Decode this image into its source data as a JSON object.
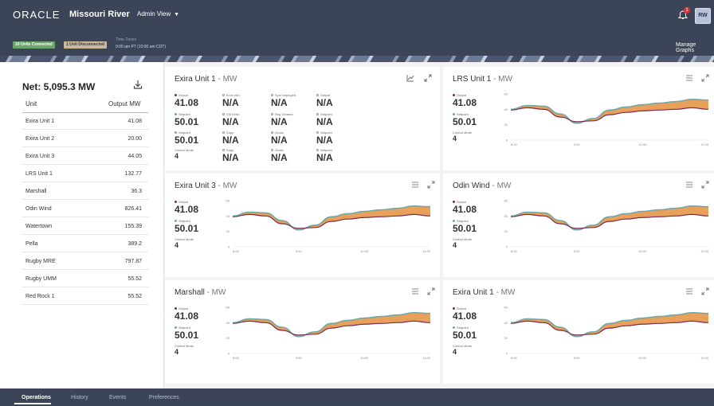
{
  "header": {
    "logo": "ORACLE",
    "app_title": "Missouri River",
    "view": "Admin View",
    "notification_count": "1",
    "avatar": "RW"
  },
  "status": {
    "connected": "10 Units Connected",
    "disconnected": "1 Unit Disconnected",
    "tz_label": "Time Zones",
    "tz_value": "9:00 am PT (10:00 am CDT)",
    "manage_graphs": "Manage Graphs"
  },
  "units_panel": {
    "net": "Net: 5,095.3 MW",
    "col_unit": "Unit",
    "col_output": "Output MW",
    "rows": [
      {
        "name": "Exira Unit 1",
        "value": "41.08"
      },
      {
        "name": "Exira Unit 2",
        "value": "20.00"
      },
      {
        "name": "Exira Unit 3",
        "value": "44.05"
      },
      {
        "name": "LRS Unit 1",
        "value": "132.77"
      },
      {
        "name": "Marshall",
        "value": "36.3"
      },
      {
        "name": "Odin Wind",
        "value": "826.41"
      },
      {
        "name": "Watertown",
        "value": "155.39"
      },
      {
        "name": "Pella",
        "value": "389.2"
      },
      {
        "name": "Rugby MRE",
        "value": "797.87"
      },
      {
        "name": "Rugby UMM",
        "value": "55.52"
      },
      {
        "name": "Red Rock 1",
        "value": "55.52"
      }
    ]
  },
  "detail_card": {
    "title": "Exira Unit 1",
    "unit": " - MW",
    "fields": [
      {
        "label": "Output",
        "value": "41.08"
      },
      {
        "label": "Setpoint",
        "value": "50.01"
      },
      {
        "label": "Setpoint",
        "value": "50.01"
      },
      {
        "label": "Control Mode",
        "value": "4"
      },
      {
        "label": "Econ Min",
        "value": "N/A"
      },
      {
        "label": "CM Echo",
        "value": "N/A"
      },
      {
        "label": "Supp",
        "value": "N/A"
      },
      {
        "label": "Supp",
        "value": "N/A"
      },
      {
        "label": "Spin Deployed",
        "value": "N/A"
      },
      {
        "label": "Reg Cleared",
        "value": "N/A"
      },
      {
        "label": "Gross",
        "value": "N/A"
      },
      {
        "label": "Gross",
        "value": "N/A"
      },
      {
        "label": "Output",
        "value": "N/A"
      },
      {
        "label": "Setpoint",
        "value": "N/A"
      },
      {
        "label": "Setpoint",
        "value": "N/A"
      },
      {
        "label": "Setpoint",
        "value": "N/A"
      }
    ]
  },
  "chart_cards": [
    {
      "title": "LRS Unit 1",
      "unit": " - MW"
    },
    {
      "title": "Exira Unit 3",
      "unit": " - MW"
    },
    {
      "title": "Odin Wind",
      "unit": " - MW"
    },
    {
      "title": "Marshall",
      "unit": " - MW"
    },
    {
      "title": "Exira Unit 1",
      "unit": " - MW"
    }
  ],
  "mini_stats": {
    "output_label": "Output",
    "output_value": "41.08",
    "setpoint_label": "Setpoint",
    "setpoint_value": "50.01",
    "mode_label": "Control Mode",
    "mode_value": "4"
  },
  "chart_data": {
    "type": "area",
    "x": [
      "8:00",
      "8:15",
      "8:30",
      "8:45",
      "9:00",
      "9:15",
      "9:30",
      "9:45",
      "10:00",
      "10:15",
      "10:30",
      "10:45",
      "11:00"
    ],
    "series": [
      {
        "name": "Output",
        "values": [
          40,
          45,
          44,
          34,
          22,
          28,
          39,
          43,
          46,
          48,
          50,
          53,
          52
        ]
      },
      {
        "name": "Setpoint",
        "values": [
          39,
          42,
          40,
          30,
          24,
          25,
          33,
          36,
          38,
          39,
          40,
          42,
          40
        ]
      }
    ],
    "y_ticks": [
      "0",
      "20",
      "40",
      "60"
    ],
    "x_ticks": [
      "8:00",
      "9:00",
      "10:00",
      "11:00"
    ],
    "ylim": [
      0,
      60
    ],
    "colors": {
      "output": "#6fa8a8",
      "setpoint": "#7b2d4f",
      "fill": "#e8a05a"
    }
  },
  "colors": {
    "header": "#3c4458",
    "connected": "#6aa56a",
    "disconnected": "#c9b89c"
  },
  "nav": {
    "tabs": [
      "Operations",
      "History",
      "Events",
      "Preferences"
    ],
    "active": "Operations"
  }
}
